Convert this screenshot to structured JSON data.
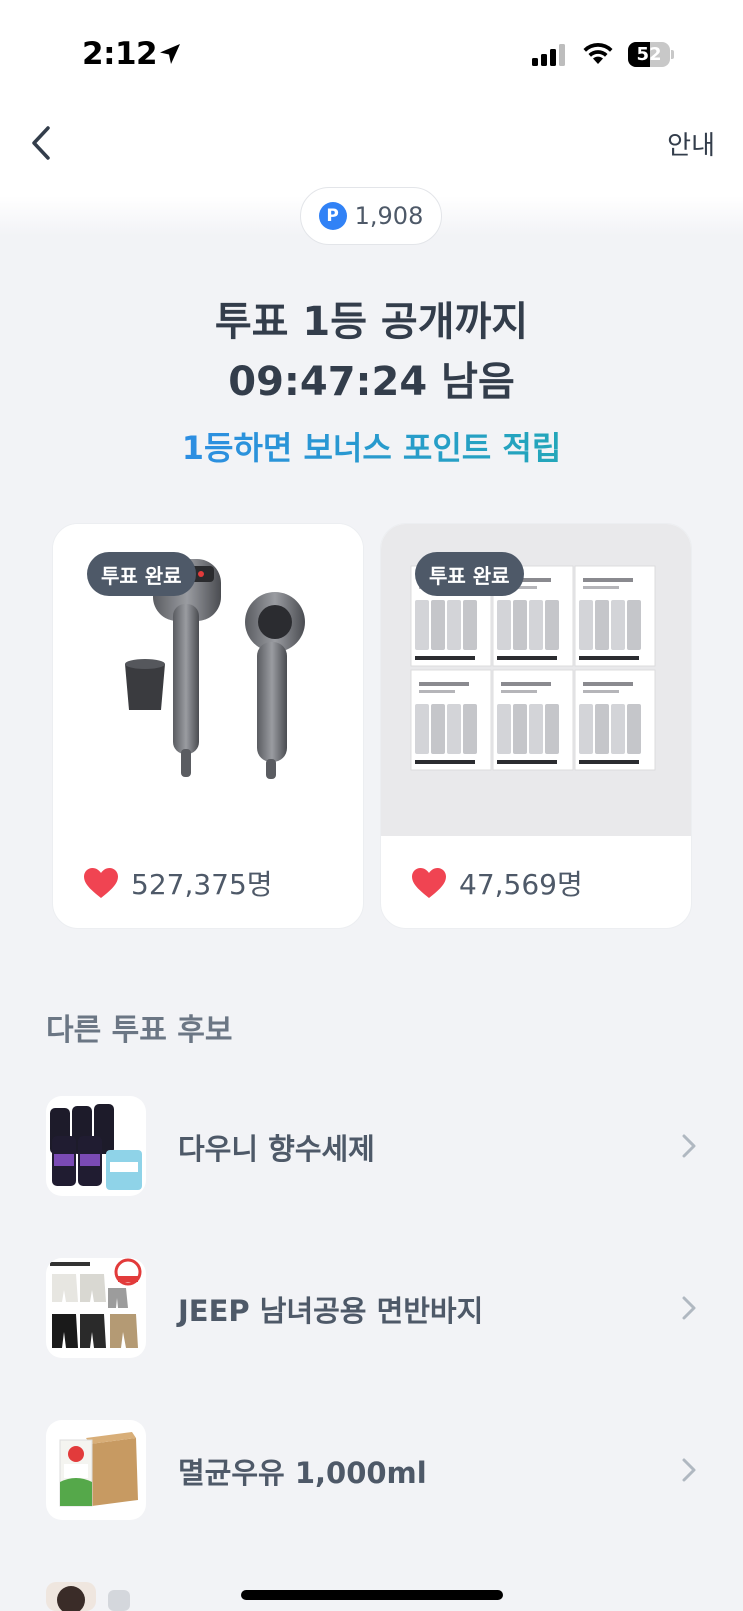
{
  "status_bar": {
    "time": "2:12",
    "battery": "52",
    "battery_level": 0.52
  },
  "header": {
    "info_label": "안내"
  },
  "points": {
    "icon_letter": "P",
    "value": "1,908"
  },
  "headline": {
    "line1": "투표 1등 공개까지",
    "line2": "09:47:24 남음"
  },
  "bonus": {
    "text": "1등하면 보너스 포인트 적립"
  },
  "vote_cards": [
    {
      "badge": "투표 완료",
      "count": "527,375명",
      "product": "hair-dryer"
    },
    {
      "badge": "투표 완료",
      "count": "47,569명",
      "product": "lint-roller-refills"
    }
  ],
  "other_candidates": {
    "title": "다른 투표 후보",
    "items": [
      {
        "name": "다우니 향수세제"
      },
      {
        "name": "JEEP 남녀공용 면반바지"
      },
      {
        "name": "멸균우유 1,000ml"
      }
    ]
  },
  "colors": {
    "accent_blue": "#3182f6",
    "accent_teal": "#1fb2a6",
    "badge_bg": "#4e5968",
    "heart": "#f04452"
  }
}
